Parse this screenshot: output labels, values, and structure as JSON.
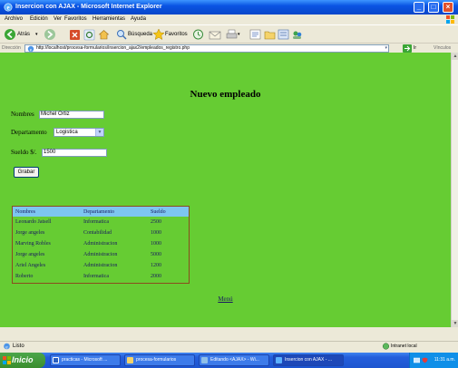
{
  "window": {
    "title": "Insercion con AJAX - Microsoft Internet Explorer"
  },
  "menu": [
    "Archivo",
    "Edición",
    "Ver",
    "Favoritos",
    "Herramientas",
    "Ayuda"
  ],
  "toolbar": {
    "back_label": "Atrás",
    "search_label": "Búsqueda",
    "favorites_label": "Favoritos"
  },
  "address": {
    "label": "Dirección",
    "url": "http://localhost/procesa-formularios/insercion_ajax2/empleados_registro.php",
    "go_label": "Ir",
    "links_label": "Vínculos"
  },
  "page": {
    "title": "Nuevo empleado",
    "nombres_label": "Nombres",
    "nombres_value": "Michel Ortiz",
    "departamento_label": "Departamento",
    "departamento_value": "Logistica",
    "sueldo_label": "Sueldo $/.",
    "sueldo_value": "1500",
    "grabar_label": "Grabar",
    "menu_link": "Menú"
  },
  "table": {
    "headers": [
      "Nombres",
      "Departamento",
      "Sueldo"
    ],
    "rows": [
      [
        "Leonardo Jatsell",
        "Informatica",
        "2500"
      ],
      [
        "Jorge angeles",
        "Contabilidad",
        "1000"
      ],
      [
        "Marving Robles",
        "Administracion",
        "1000"
      ],
      [
        "Jorge angeles",
        "Administracion",
        "5000"
      ],
      [
        "Ariel Angeles",
        "Administracion",
        "1200"
      ],
      [
        "Roberto",
        "Informatica",
        "2000"
      ]
    ]
  },
  "status": {
    "text": "Listo",
    "zone": "Intranet local"
  },
  "taskbar": {
    "start_label": "Inicio",
    "tasks": [
      "practicas - Microsoft ...",
      "procesa-formularios",
      "Editando <AJAX> - Wi...",
      "Insercion con AJAX - ..."
    ],
    "clock": "11:31 a.m."
  },
  "colors": {
    "page_bg": "#66cc33",
    "table_header": "#7dc6f0",
    "table_border": "#8b4b1f",
    "link_text": "#1a1a60"
  }
}
